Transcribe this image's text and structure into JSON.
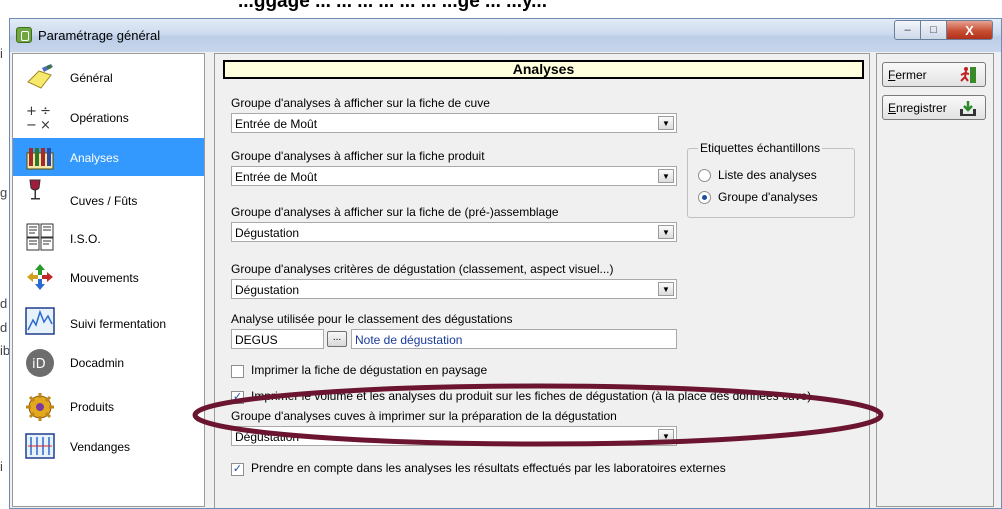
{
  "document_heading": "...ggagé ... ... ... ... ... ... ...gé ... ...y...",
  "background_fragments": [
    "i",
    "g",
    "d",
    "d",
    "ib",
    "i"
  ],
  "window": {
    "title": "Paramétrage général",
    "controls": {
      "minimize": "–",
      "maximize": "□",
      "close": "X"
    }
  },
  "sidebar": {
    "items": [
      {
        "label": "Général",
        "icon": "note-pencil-icon",
        "active": false
      },
      {
        "label": "Opérations",
        "icon": "math-operators-icon",
        "active": false
      },
      {
        "label": "Analyses",
        "icon": "lab-flasks-icon",
        "active": true
      },
      {
        "label": "Cuves / Fûts",
        "icon": "wine-glass-icon",
        "active": false
      },
      {
        "label": "I.S.O.",
        "icon": "iso-document-icon",
        "active": false
      },
      {
        "label": "Mouvements",
        "icon": "arrows-movement-icon",
        "active": false
      },
      {
        "label": "Suivi fermentation",
        "icon": "fermentation-chart-icon",
        "active": false
      },
      {
        "label": "Docadmin",
        "icon": "docadmin-logo-icon",
        "active": false
      },
      {
        "label": "Produits",
        "icon": "gear-gold-icon",
        "active": false
      },
      {
        "label": "Vendanges",
        "icon": "vendanges-chart-icon",
        "active": false
      }
    ]
  },
  "main": {
    "section_title": "Analyses",
    "field_cuve": {
      "label": "Groupe d'analyses à afficher sur la fiche de cuve",
      "value": "Entrée de Moût"
    },
    "field_produit": {
      "label": "Groupe d'analyses à afficher sur la fiche produit",
      "value": "Entrée de Moût"
    },
    "field_assemblage": {
      "label": "Groupe d'analyses à afficher sur la fiche de (pré-)assemblage",
      "value": "Dégustation"
    },
    "field_criteres": {
      "label": "Groupe d'analyses critères de dégustation (classement, aspect visuel...)",
      "value": "Dégustation"
    },
    "field_classement": {
      "label": "Analyse utilisée pour le classement des dégustations",
      "code": "DEGUS",
      "browse": "...",
      "description": "Note de dégustation"
    },
    "etiquettes": {
      "title": "Etiquettes échantillons",
      "options": [
        "Liste des analyses",
        "Groupe d'analyses"
      ],
      "selected": "Groupe d'analyses"
    },
    "chk_paysage": {
      "label": "Imprimer la fiche de dégustation en paysage",
      "checked": false
    },
    "chk_volume": {
      "label": "Imprimer le volume et les analyses du produit sur les fiches de dégustation (à la place des données cuve)",
      "checked": true
    },
    "field_preparation": {
      "label": "Groupe d'analyses cuves à imprimer sur la préparation de la dégustation",
      "value": "Dégustation"
    },
    "chk_externes": {
      "label": "Prendre en compte dans les analyses les résultats effectués par les laboratoires externes",
      "checked": true
    }
  },
  "actions": {
    "close": {
      "underline": "F",
      "rest": "ermer",
      "icon": "exit-runner-icon"
    },
    "save": {
      "underline": "E",
      "rest": "nregistrer",
      "icon": "save-tray-icon"
    }
  },
  "annotation": {
    "shape": "ellipse",
    "color": "#6b1530"
  },
  "colors": {
    "selection": "#3399ff",
    "title_bg": "#ffffde",
    "annotation": "#6b1530"
  }
}
